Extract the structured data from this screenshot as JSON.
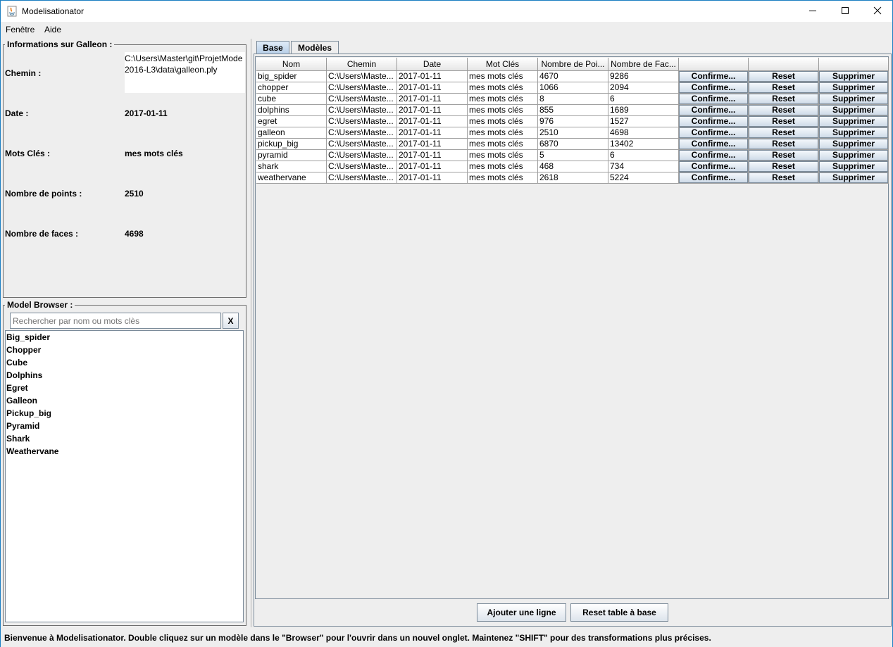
{
  "window": {
    "title": "Modelisationator"
  },
  "menu": {
    "items": [
      "Fenêtre",
      "Aide"
    ]
  },
  "info": {
    "title": "Informations sur Galleon :",
    "path_label": "Chemin :",
    "path_value_line1": "C:\\Users\\Master\\git\\ProjetMode",
    "path_value_line2": "2016-L3\\data\\galleon.ply",
    "date_label": "Date :",
    "date_value": "2017-01-11",
    "keywords_label": "Mots Clés :",
    "keywords_value": "mes mots clés",
    "points_label": "Nombre de points :",
    "points_value": "2510",
    "faces_label": "Nombre de faces :",
    "faces_value": "4698"
  },
  "browser": {
    "title": "Model Browser :",
    "search_placeholder": "Rechercher par nom ou mots clès",
    "clear_label": "X",
    "items": [
      "Big_spider",
      "Chopper",
      "Cube",
      "Dolphins",
      "Egret",
      "Galleon",
      "Pickup_big",
      "Pyramid",
      "Shark",
      "Weathervane"
    ]
  },
  "tabs": [
    {
      "label": "Base",
      "active": true
    },
    {
      "label": "Modèles",
      "active": false
    }
  ],
  "table": {
    "columns": [
      "Nom",
      "Chemin",
      "Date",
      "Mot Clés",
      "Nombre de Poi...",
      "Nombre de Fac...",
      "",
      "",
      ""
    ],
    "rows": [
      [
        "big_spider",
        "C:\\Users\\Maste...",
        "2017-01-11",
        "mes mots clés",
        "4670",
        "9286"
      ],
      [
        "chopper",
        "C:\\Users\\Maste...",
        "2017-01-11",
        "mes mots clés",
        "1066",
        "2094"
      ],
      [
        "cube",
        "C:\\Users\\Maste...",
        "2017-01-11",
        "mes mots clés",
        "8",
        "6"
      ],
      [
        "dolphins",
        "C:\\Users\\Maste...",
        "2017-01-11",
        "mes mots clés",
        "855",
        "1689"
      ],
      [
        "egret",
        "C:\\Users\\Maste...",
        "2017-01-11",
        "mes mots clés",
        "976",
        "1527"
      ],
      [
        "galleon",
        "C:\\Users\\Maste...",
        "2017-01-11",
        "mes mots clés",
        "2510",
        "4698"
      ],
      [
        "pickup_big",
        "C:\\Users\\Maste...",
        "2017-01-11",
        "mes mots clés",
        "6870",
        "13402"
      ],
      [
        "pyramid",
        "C:\\Users\\Maste...",
        "2017-01-11",
        "mes mots clés",
        "5",
        "6"
      ],
      [
        "shark",
        "C:\\Users\\Maste...",
        "2017-01-11",
        "mes mots clés",
        "468",
        "734"
      ],
      [
        "weathervane",
        "C:\\Users\\Maste...",
        "2017-01-11",
        "mes mots clés",
        "2618",
        "5224"
      ]
    ],
    "row_buttons": [
      "Confirme...",
      "Reset",
      "Supprimer"
    ]
  },
  "actions": {
    "add_row": "Ajouter une ligne",
    "reset_table": "Reset table à base"
  },
  "status": {
    "message": "Bienvenue à Modelisationator. Double cliquez sur un modèle dans le \"Browser\" pour l'ouvrir dans un nouvel onglet. Maintenez \"SHIFT\" pour des transformations plus précises."
  }
}
